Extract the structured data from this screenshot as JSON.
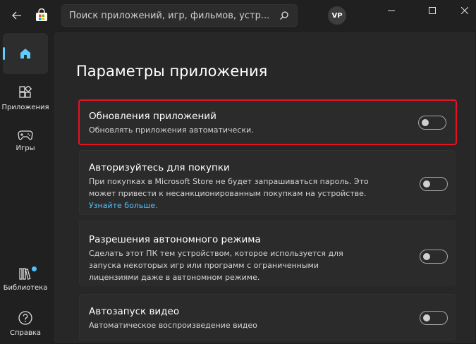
{
  "search": {
    "placeholder": "Поиск приложений, игр, фильмов, устр..."
  },
  "account": {
    "initials": "VP"
  },
  "sidebar": {
    "items": [
      {
        "label": "",
        "icon": "home-icon",
        "active": true
      },
      {
        "label": "Приложения",
        "icon": "apps-icon"
      },
      {
        "label": "Игры",
        "icon": "gamepad-icon"
      },
      {
        "label": "Библиотека",
        "icon": "library-icon",
        "badge": true
      },
      {
        "label": "Справка",
        "icon": "help-icon"
      }
    ]
  },
  "page": {
    "title": "Параметры приложения",
    "settings": [
      {
        "title": "Обновления приложений",
        "description": "Обновлять приложения автоматически.",
        "enabled": false,
        "highlighted": true
      },
      {
        "title": "Авторизуйтесь для покупки",
        "description": "При покупках в Microsoft Store не будет запрашиваться пароль. Это может привести к несанкционированным покупкам на устройстве.",
        "link": "Узнайте больше.",
        "enabled": false
      },
      {
        "title": "Разрешения автономного режима",
        "description": "Сделать этот ПК тем устройством, которое используется для запуска некоторых игр или программ с ограниченными лицензиями даже в автономном режиме.",
        "enabled": false
      },
      {
        "title": "Автозапуск видео",
        "description": "Автоматическое воспроизведение видео",
        "enabled": false
      }
    ]
  },
  "colors": {
    "accent": "#60cdff",
    "highlight": "#e81123",
    "link": "#4cc2ff"
  }
}
